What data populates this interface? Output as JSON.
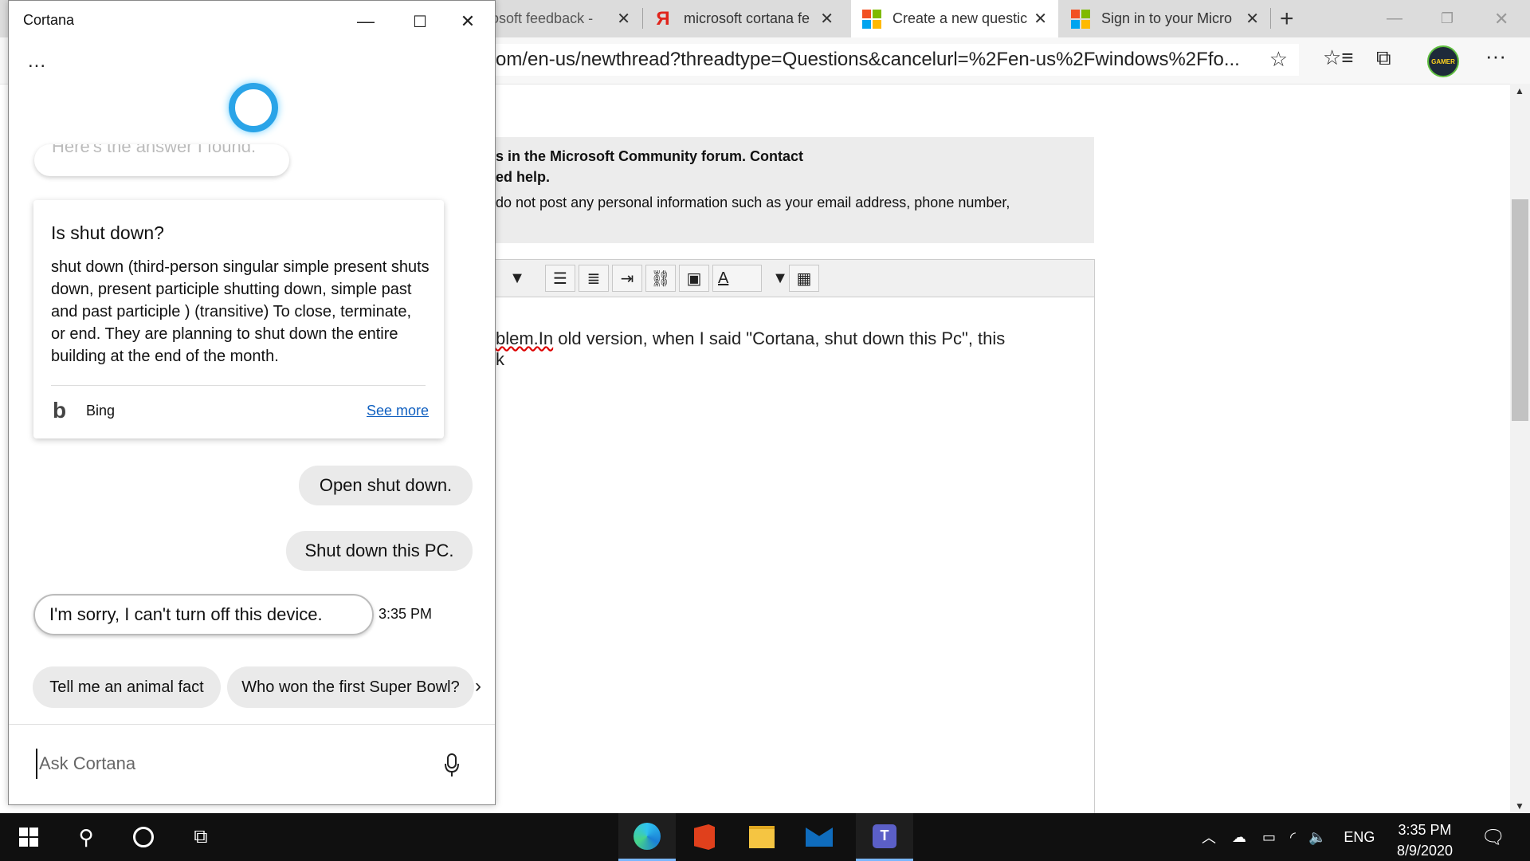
{
  "browser": {
    "tabs": [
      {
        "label": "rosoft feedback -",
        "icon": "ms-feedback-icon"
      },
      {
        "label": "microsoft cortana fe",
        "icon": "yandex-icon"
      },
      {
        "label": "Create a new questic",
        "icon": "microsoft-logo-icon"
      },
      {
        "label": "Sign in to your Micro",
        "icon": "microsoft-logo-icon"
      }
    ],
    "new_tab": "+",
    "url": "com/en-us/newthread?threadtype=Questions&cancelurl=%2Fen-us%2Fwindows%2Ffo...",
    "profile_badge": "GAMER"
  },
  "page": {
    "notice_line1": "s in the Microsoft Community forum. Contact",
    "notice_line2": "ed help.",
    "notice_line3": "do not post any personal information such as your email address, phone number,",
    "editor_text_err": "blem.In",
    "editor_text_rest": " old version, when I said \"Cortana, shut down this Pc\", this",
    "editor_line2": "k"
  },
  "cortana": {
    "title": "Cortana",
    "more": "...",
    "partial_bubble": "Here's the answer I found.",
    "card": {
      "title": "Is shut down?",
      "body": "shut down (third-person singular simple present shuts down, present participle shutting down, simple past and past participle ) (transitive) To close, terminate, or end. They are planning to shut down the entire building at the end of the month.",
      "source": "Bing",
      "see_more": "See more"
    },
    "user_msg_1": "Open shut down.",
    "user_msg_2": "Shut down this PC.",
    "response": "I'm sorry, I can't turn off this device.",
    "response_time": "3:35 PM",
    "suggestions": [
      "Tell me an animal fact",
      "Who won the first Super Bowl?"
    ],
    "input_placeholder": "Ask Cortana"
  },
  "taskbar": {
    "language": "ENG",
    "time": "3:35 PM",
    "date": "8/9/2020"
  },
  "colors": {
    "cortana_ring": "#2aa4e8",
    "link": "#1060c0",
    "taskbar": "#101010",
    "tab_strip": "#dcdcdc"
  }
}
